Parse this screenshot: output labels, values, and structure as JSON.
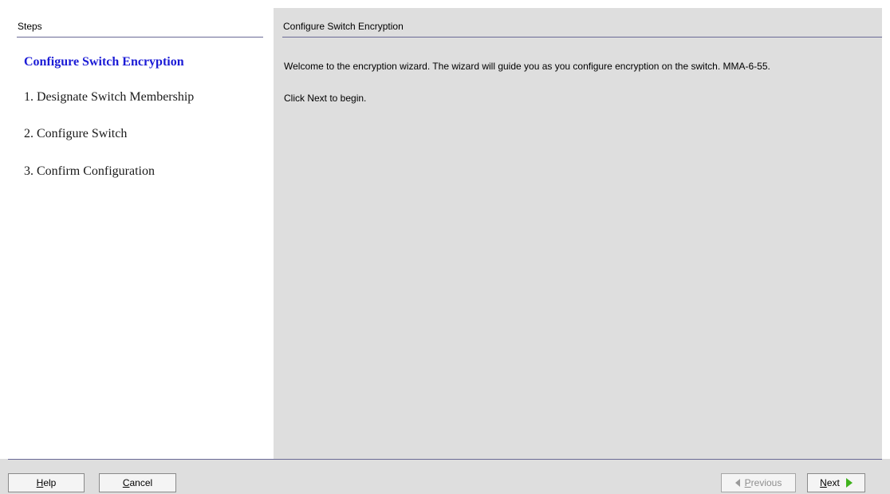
{
  "steps_panel": {
    "header": "Steps",
    "items": [
      {
        "label": "Configure Switch Encryption",
        "current": true
      },
      {
        "label": "1. Designate Switch Membership",
        "current": false
      },
      {
        "label": "2. Configure Switch",
        "current": false
      },
      {
        "label": "3. Confirm Configuration",
        "current": false
      }
    ]
  },
  "content": {
    "header": "Configure Switch Encryption",
    "welcome_text": "Welcome to the encryption wizard. The wizard will guide you as you configure encryption on the switch. MMA-6-55.",
    "instruction_text": "Click Next to begin."
  },
  "buttons": {
    "help": {
      "mnemonic": "H",
      "rest": "elp"
    },
    "cancel": {
      "mnemonic": "C",
      "rest": "ancel"
    },
    "previous": {
      "mnemonic": "P",
      "rest": "revious",
      "enabled": false,
      "icon": "left-arrow-icon"
    },
    "next": {
      "mnemonic": "N",
      "rest": "ext",
      "enabled": true,
      "icon": "right-arrow-icon"
    }
  },
  "colors": {
    "current_step": "#1b1bd6",
    "panel_background": "#dedede",
    "separator": "#6a6a96",
    "next_arrow": "#3fb21c"
  }
}
